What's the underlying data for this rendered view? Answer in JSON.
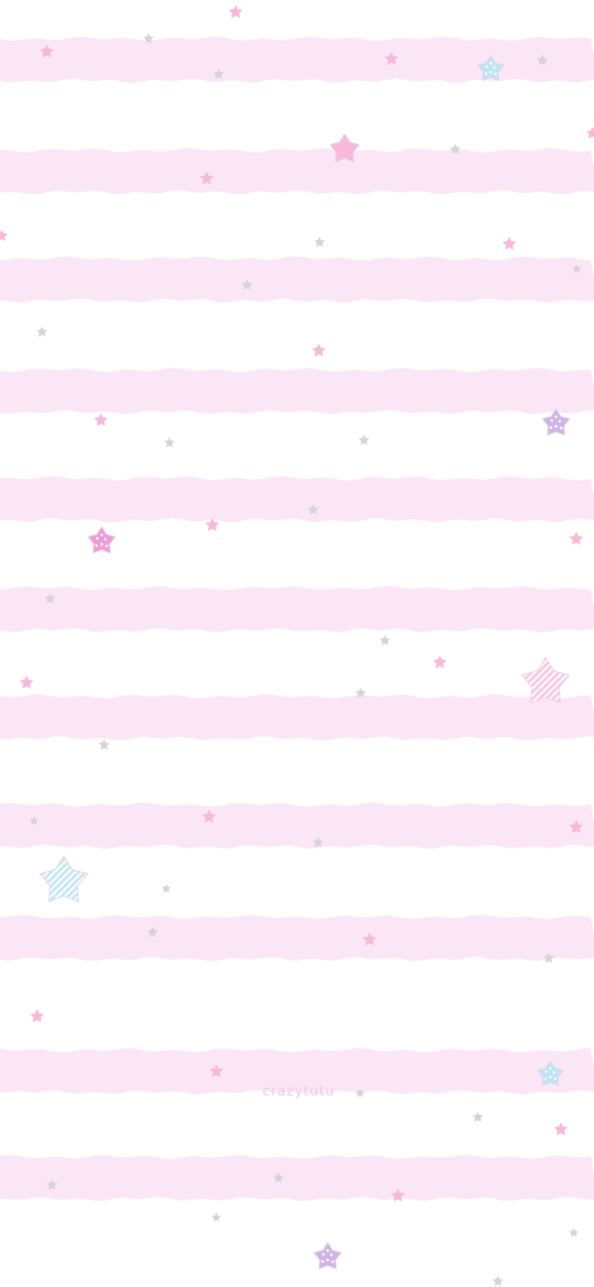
{
  "wallpaper": {
    "watermark": "crazytutu",
    "colors": {
      "background": "#ffffff",
      "stripe": "#fbe6f5",
      "star_pink": "#f7b8dc",
      "star_gray": "#d4d4d6",
      "star_blue": "#bfe4f4",
      "star_purple": "#cfb4e6",
      "star_magenta": "#ee9cd9",
      "star_outline": "#e4d7e6"
    },
    "decorations": [
      "stripes",
      "small-stars",
      "large-patterned-stars"
    ]
  }
}
